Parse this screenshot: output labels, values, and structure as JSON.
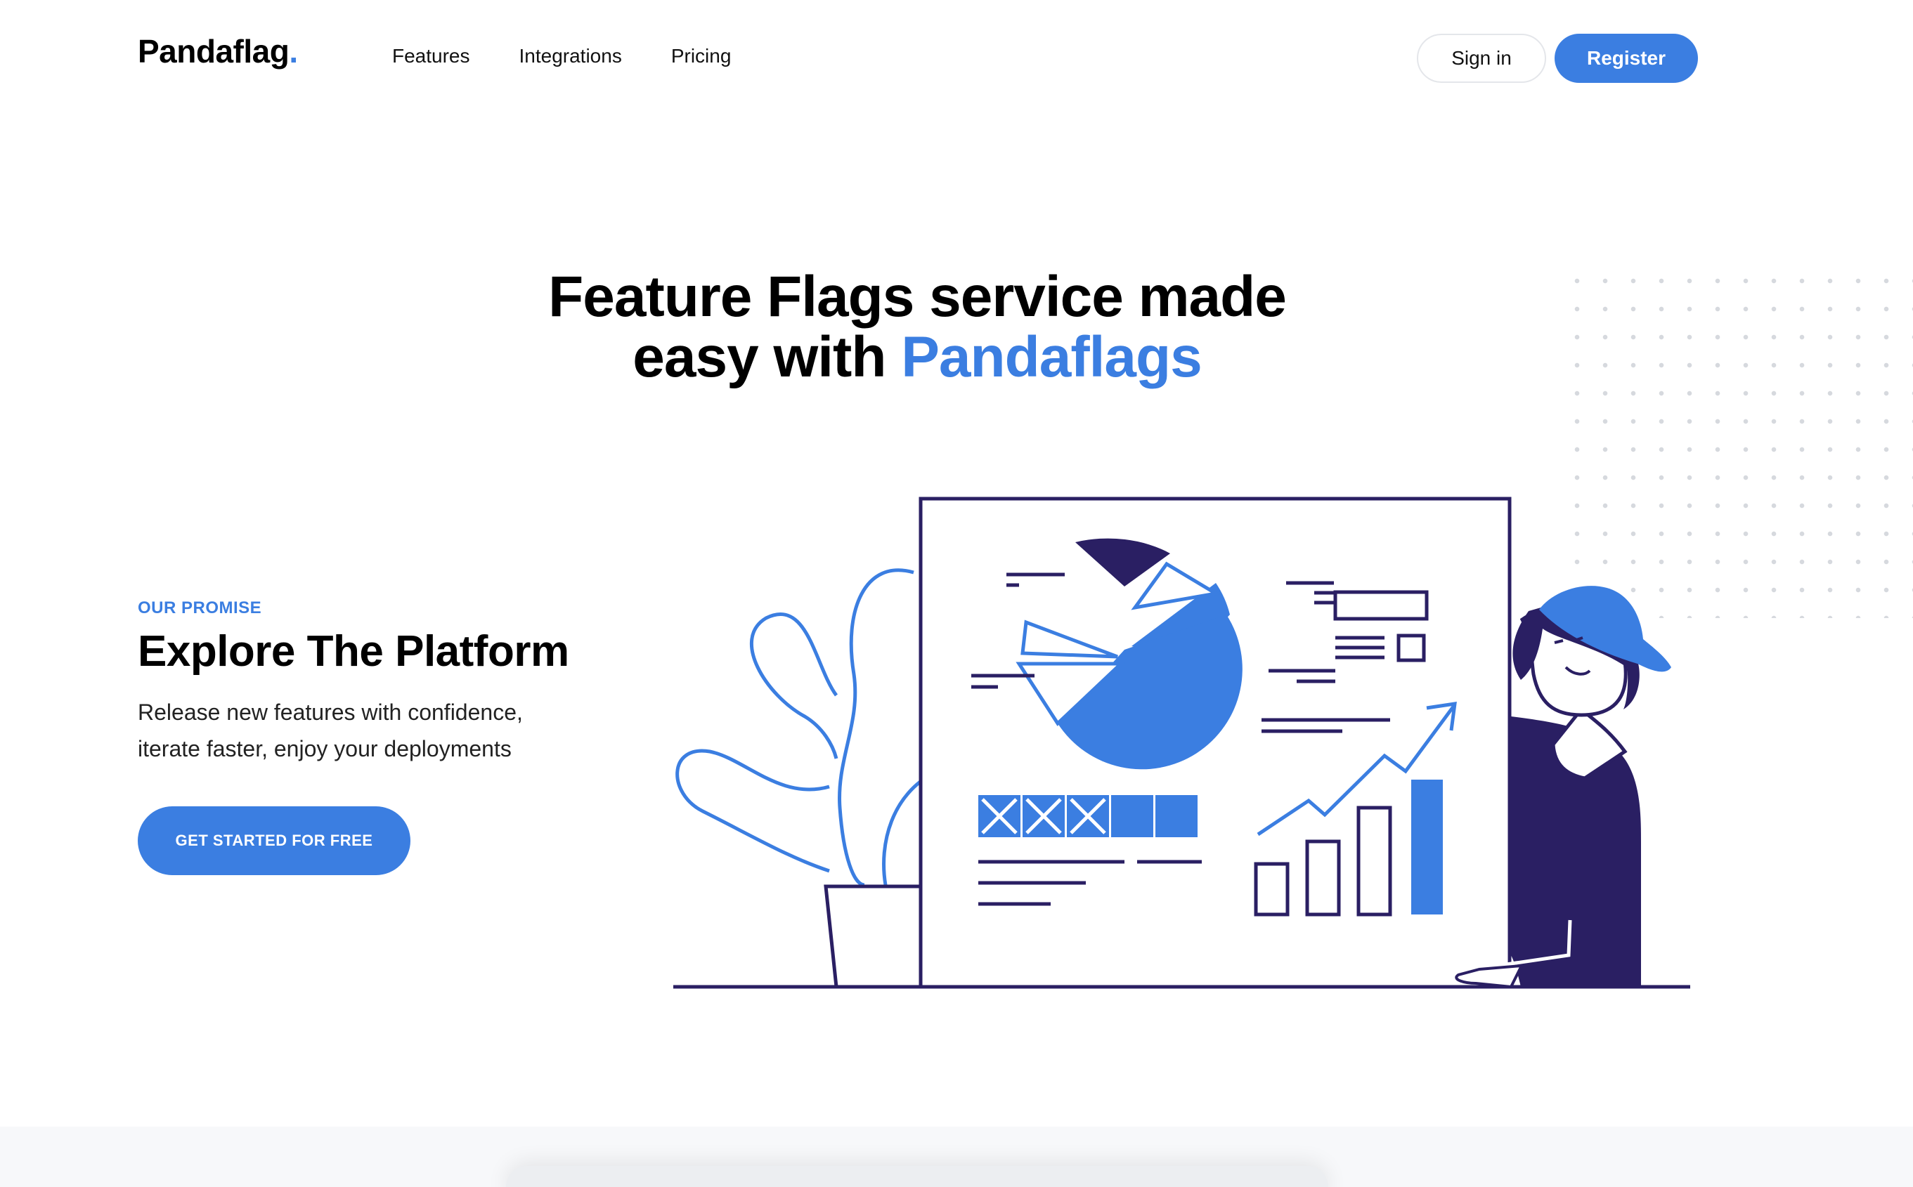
{
  "header": {
    "logo": "Pandaflag",
    "logo_dot": ".",
    "nav": [
      "Features",
      "Integrations",
      "Pricing"
    ],
    "sign_in": "Sign in",
    "register": "Register"
  },
  "hero": {
    "title_line1": "Feature Flags service made",
    "title_line2_prefix": "easy with ",
    "title_line2_accent": "Pandaflags"
  },
  "promise": {
    "eyebrow": "OUR PROMISE",
    "title": "Explore The Platform",
    "text_line1": "Release new features with confidence,",
    "text_line2": "iterate faster, enjoy your deployments",
    "cta": "GET STARTED FOR FREE"
  },
  "colors": {
    "accent": "#3b7ee1",
    "navy": "#2a1f63",
    "text": "#000000"
  }
}
